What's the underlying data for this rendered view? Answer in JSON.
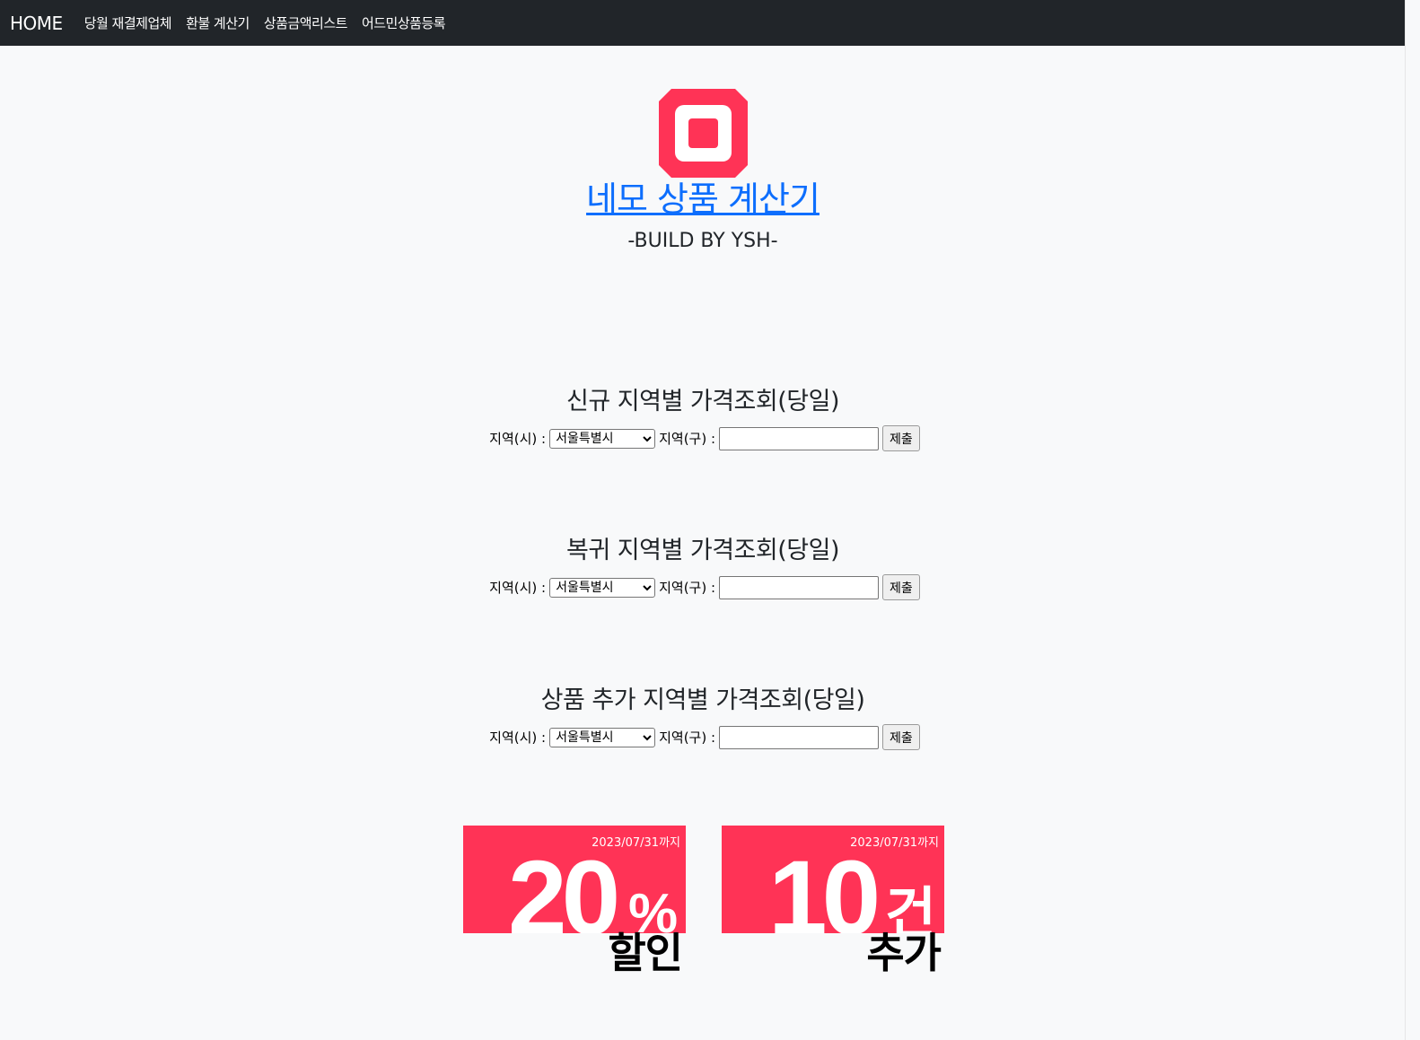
{
  "nav": {
    "brand": "HOME",
    "items": [
      {
        "label": "당월 재결제업체"
      },
      {
        "label": "환불 계산기"
      },
      {
        "label": "상품금액리스트"
      },
      {
        "label": "어드민상품등록"
      }
    ]
  },
  "hero": {
    "title": "네모 상품 계산기",
    "subtitle": "-BUILD BY YSH-"
  },
  "sections": [
    {
      "title": "신규 지역별 가격조회(당일)",
      "city_label": "지역(시) :",
      "city_selected": "서울특별시",
      "district_label": "지역(구) :",
      "district_value": "",
      "submit_label": "제출"
    },
    {
      "title": "복귀 지역별 가격조회(당일)",
      "city_label": "지역(시) :",
      "city_selected": "서울특별시",
      "district_label": "지역(구) :",
      "district_value": "",
      "submit_label": "제출"
    },
    {
      "title": "상품 추가 지역별 가격조회(당일)",
      "city_label": "지역(시) :",
      "city_selected": "서울특별시",
      "district_label": "지역(구) :",
      "district_value": "",
      "submit_label": "제출"
    }
  ],
  "banners": [
    {
      "date": "2023/07/31까지",
      "number": "20",
      "unit": "%",
      "word": "할인"
    },
    {
      "date": "2023/07/31까지",
      "number": "10",
      "unit": "건",
      "word": "추가"
    }
  ],
  "colors": {
    "navbar": "#212529",
    "accent": "#ff3356",
    "link": "#0d6efd",
    "background": "#f8f9fa"
  }
}
